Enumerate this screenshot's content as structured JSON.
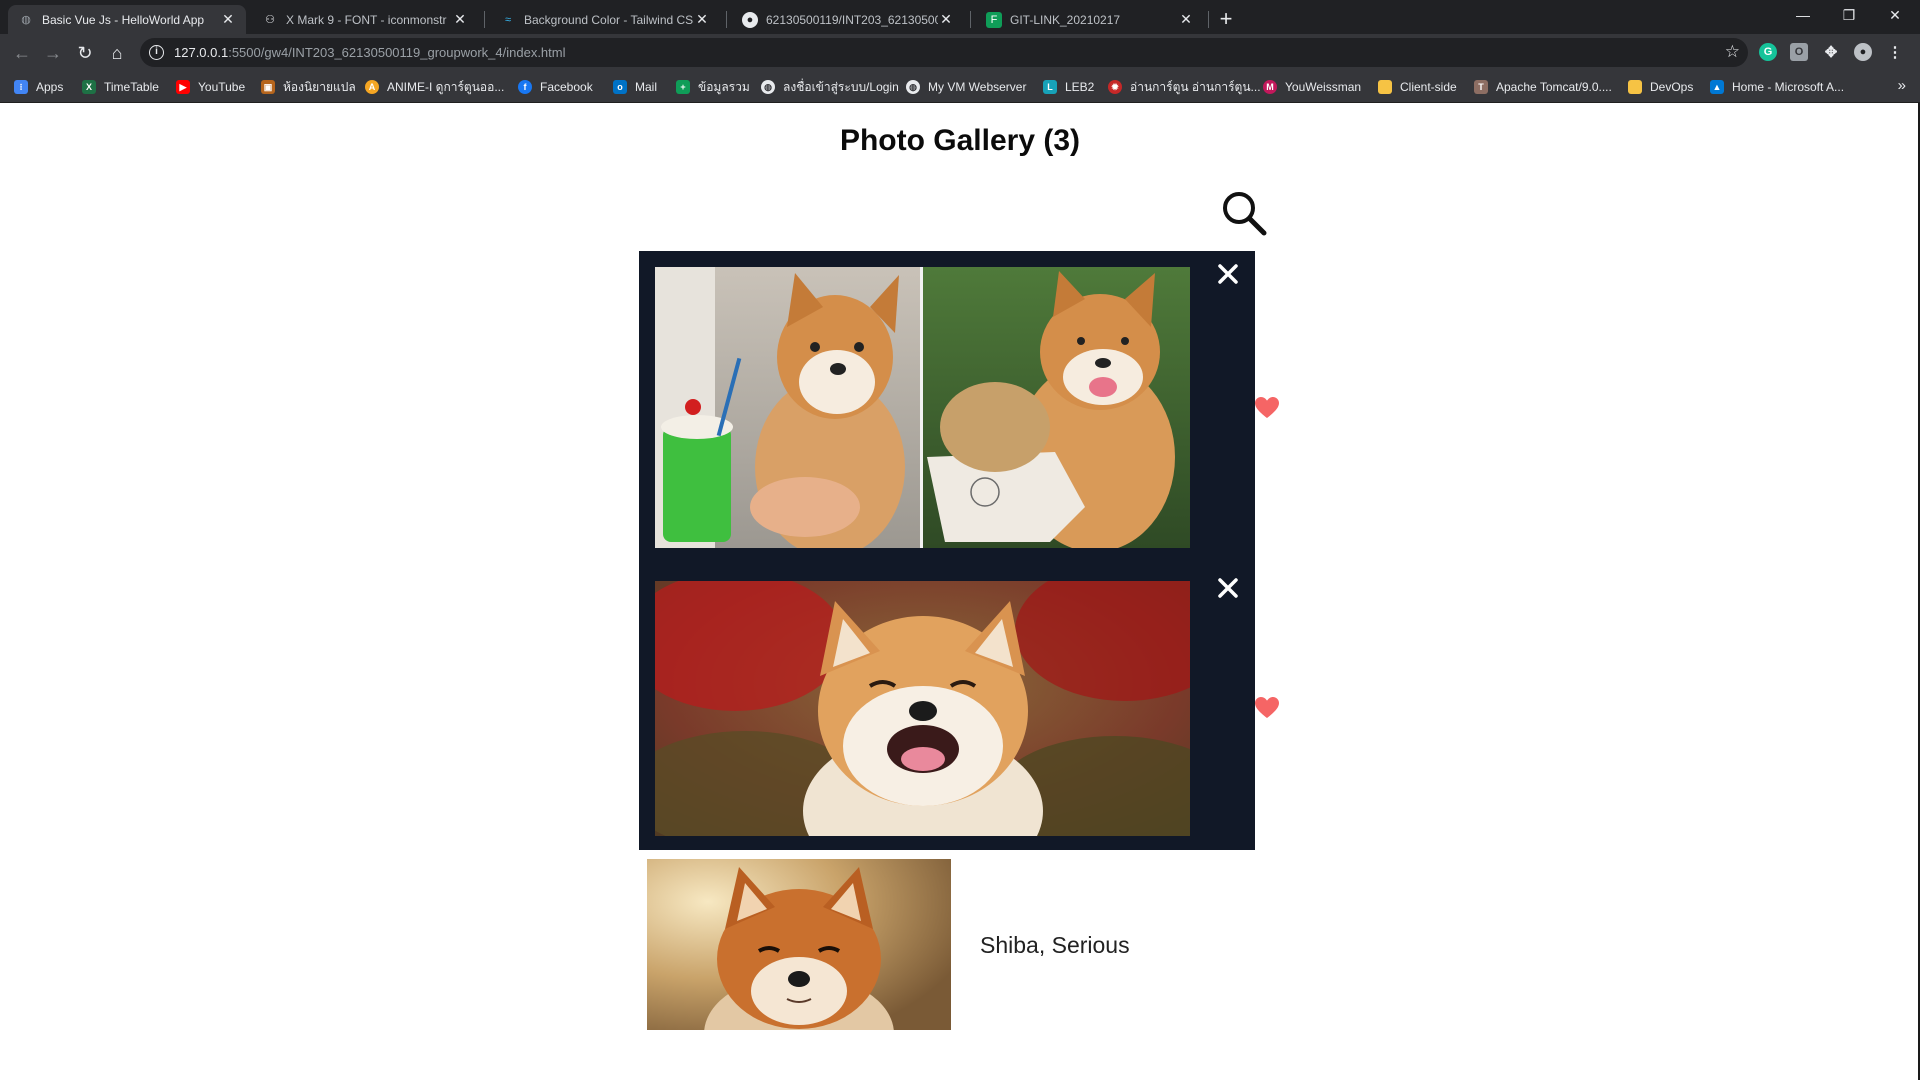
{
  "browser": {
    "tabs": [
      {
        "title": "Basic Vue Js - HelloWorld App",
        "icon": "globe-icon",
        "active": true
      },
      {
        "title": "X Mark 9 - FONT - iconmonstr",
        "icon": "iconmonstr-icon",
        "active": false
      },
      {
        "title": "Background Color - Tailwind CSS",
        "icon": "tailwind-icon",
        "active": false
      },
      {
        "title": "62130500119/INT203_62130500",
        "icon": "github-icon",
        "active": false
      },
      {
        "title": "GIT-LINK_20210217",
        "icon": "sheet-icon",
        "active": false
      }
    ],
    "url_host": "127.0.0.1",
    "url_rest": ":5500/gw4/INT203_62130500119_groupwork_4/index.html",
    "bookmarks": [
      {
        "label": "Apps",
        "icon": "apps-grid-icon",
        "color": "#e94235"
      },
      {
        "label": "TimeTable",
        "icon": "excel-icon",
        "color": "#1e7145"
      },
      {
        "label": "YouTube",
        "icon": "youtube-icon",
        "color": "#ff0000"
      },
      {
        "label": "ห้องนิยายแปล",
        "icon": "image-icon",
        "color": "#b5651d"
      },
      {
        "label": "ANIME-I ดูการ์ตูนออ...",
        "icon": "anime-icon",
        "color": "#f5a623"
      },
      {
        "label": "Facebook",
        "icon": "facebook-icon",
        "color": "#1877f2"
      },
      {
        "label": "Mail",
        "icon": "outlook-icon",
        "color": "#0072c6"
      },
      {
        "label": "ข้อมูลรวม",
        "icon": "sheets-icon",
        "color": "#0f9d58"
      },
      {
        "label": "ลงชื่อเข้าสู่ระบบ/Login",
        "icon": "globe-icon",
        "color": "#5f6368"
      },
      {
        "label": "My VM Webserver",
        "icon": "globe-icon",
        "color": "#5f6368"
      },
      {
        "label": "LEB2",
        "icon": "leb2-icon",
        "color": "#17a2b8"
      },
      {
        "label": "อ่านการ์ตูน อ่านการ์ตูน...",
        "icon": "manga-icon",
        "color": "#c62828"
      },
      {
        "label": "YouWeissman",
        "icon": "m-icon",
        "color": "#c2185b"
      },
      {
        "label": "Client-side",
        "icon": "folder-icon",
        "color": "#f6c344"
      },
      {
        "label": "Apache Tomcat/9.0....",
        "icon": "tomcat-icon",
        "color": "#8d6e63"
      },
      {
        "label": "DevOps",
        "icon": "folder-icon",
        "color": "#f6c344"
      },
      {
        "label": "Home - Microsoft A...",
        "icon": "azure-icon",
        "color": "#0078d4"
      }
    ]
  },
  "page": {
    "title": "Photo Gallery (3)",
    "photos": [
      {
        "alt": "Shiba with melon soda and shiba with mont blanc",
        "favorite": true
      },
      {
        "alt": "Smiling shiba in red flowers",
        "favorite": true
      },
      {
        "alt": "Shiba, Serious",
        "caption": "Shiba, Serious"
      }
    ]
  },
  "colors": {
    "gallery_bg": "#111827",
    "heart": "#f56565",
    "close": "#ffffff"
  }
}
